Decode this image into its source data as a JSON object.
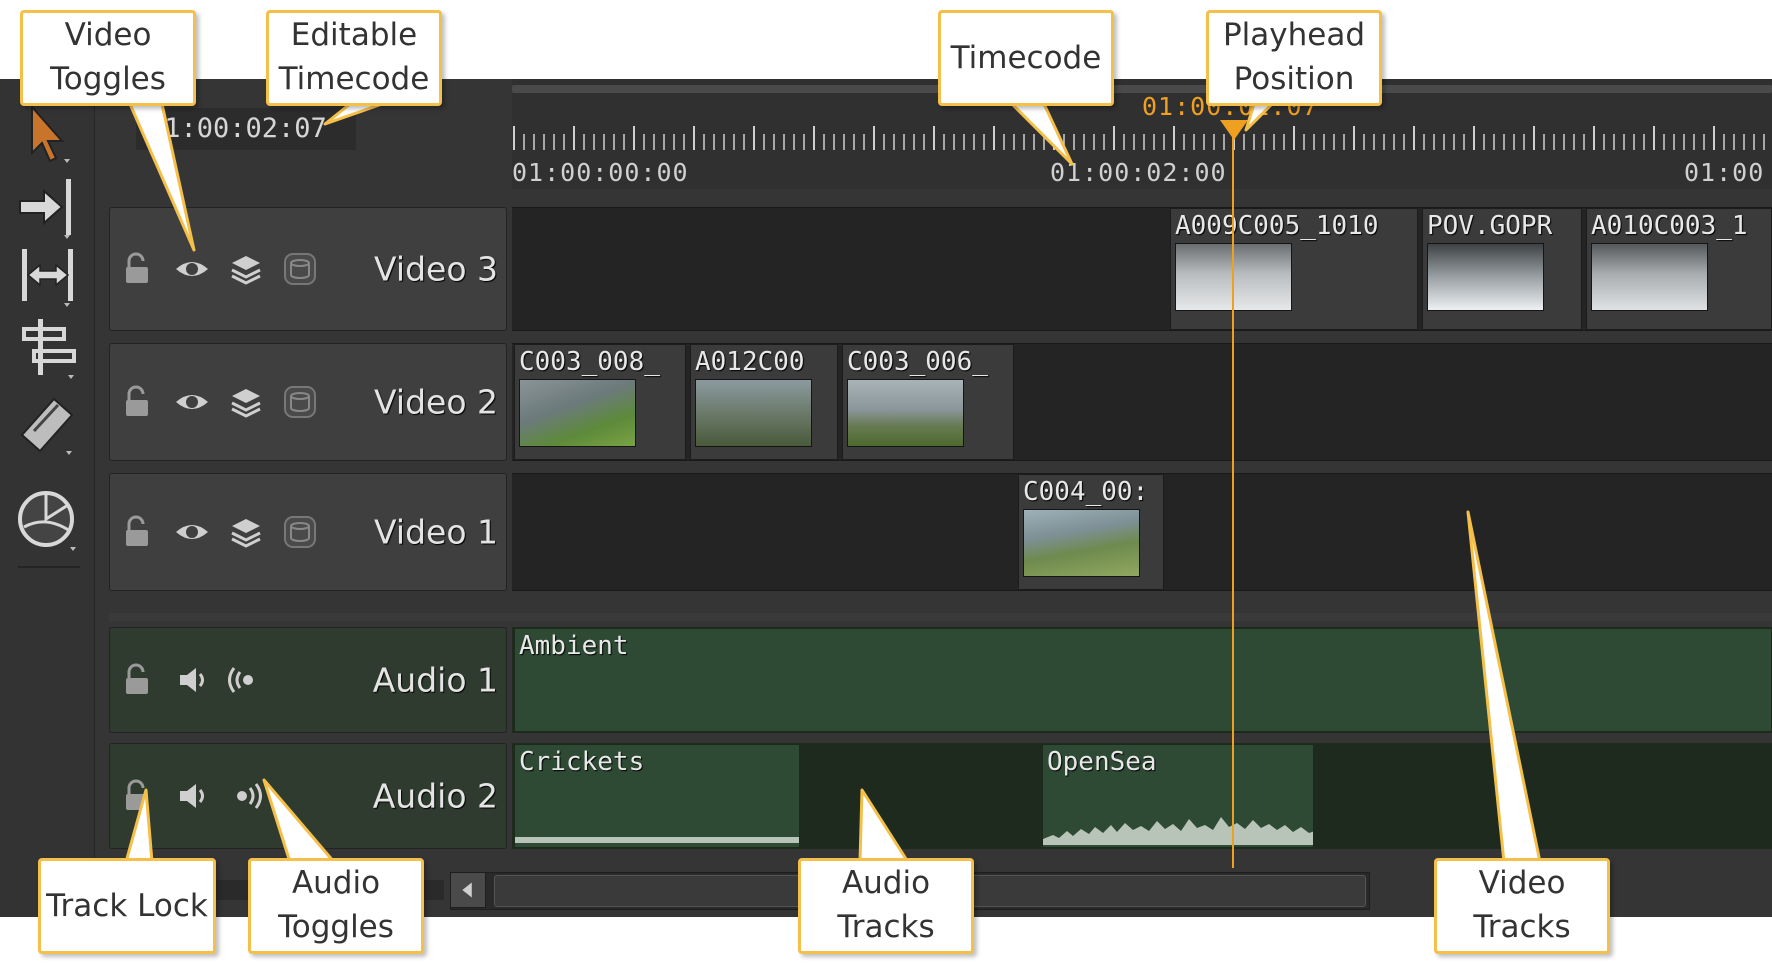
{
  "timecode": {
    "editable_value": "01:00:02:07",
    "playhead_value": "01:00:02:07"
  },
  "ruler": {
    "labels": [
      "01:00:00:00",
      "01:00:02:00",
      "01:00"
    ]
  },
  "video_tracks": [
    {
      "name": "Video 3",
      "clips": [
        {
          "name": "A009C005_1010",
          "thumb": "snow-road"
        },
        {
          "name": "POV.GOPR",
          "thumb": "snow-forest"
        },
        {
          "name": "A010C003_1",
          "thumb": "snow-car"
        }
      ]
    },
    {
      "name": "Video 2",
      "clips": [
        {
          "name": "C003_008_",
          "thumb": "coast-road"
        },
        {
          "name": "A012C00",
          "thumb": "car-road"
        },
        {
          "name": "C003_006_",
          "thumb": "sea-cliff"
        }
      ]
    },
    {
      "name": "Video 1",
      "clips": [
        {
          "name": "C004_00:",
          "thumb": "cliff-path"
        }
      ]
    }
  ],
  "audio_tracks": [
    {
      "name": "Audio 1",
      "clips": [
        {
          "name": "Ambient"
        }
      ]
    },
    {
      "name": "Audio 2",
      "clips": [
        {
          "name": "Crickets"
        },
        {
          "name": "OpenSea"
        }
      ]
    }
  ],
  "icons": {
    "toolbar": [
      "select-arrow-icon",
      "track-forward-icon",
      "slip-icon",
      "multi-select-icon",
      "razor-icon",
      "render-icon"
    ],
    "video_header": [
      "lock-icon",
      "eye-icon",
      "layers-icon",
      "blend-icon"
    ],
    "audio_header": [
      "lock-icon",
      "speaker-icon",
      "audio-channel-icon"
    ]
  },
  "callouts": {
    "video_toggles": [
      "Video",
      "Toggles"
    ],
    "editable_timecode": [
      "Editable",
      "Timecode"
    ],
    "timecode": [
      "Timecode"
    ],
    "playhead_position": [
      "Playhead",
      "Position"
    ],
    "track_lock": [
      "Track Lock"
    ],
    "audio_toggles": [
      "Audio",
      "Toggles"
    ],
    "audio_tracks": [
      "Audio",
      "Tracks"
    ],
    "video_tracks": [
      "Video",
      "Tracks"
    ]
  },
  "colors": {
    "callout_border": "#f5c04a",
    "playhead": "#f0a020",
    "video_lane": "#242424",
    "audio_lane": "#1f2a1f",
    "audio_clip": "#2e4a34"
  }
}
